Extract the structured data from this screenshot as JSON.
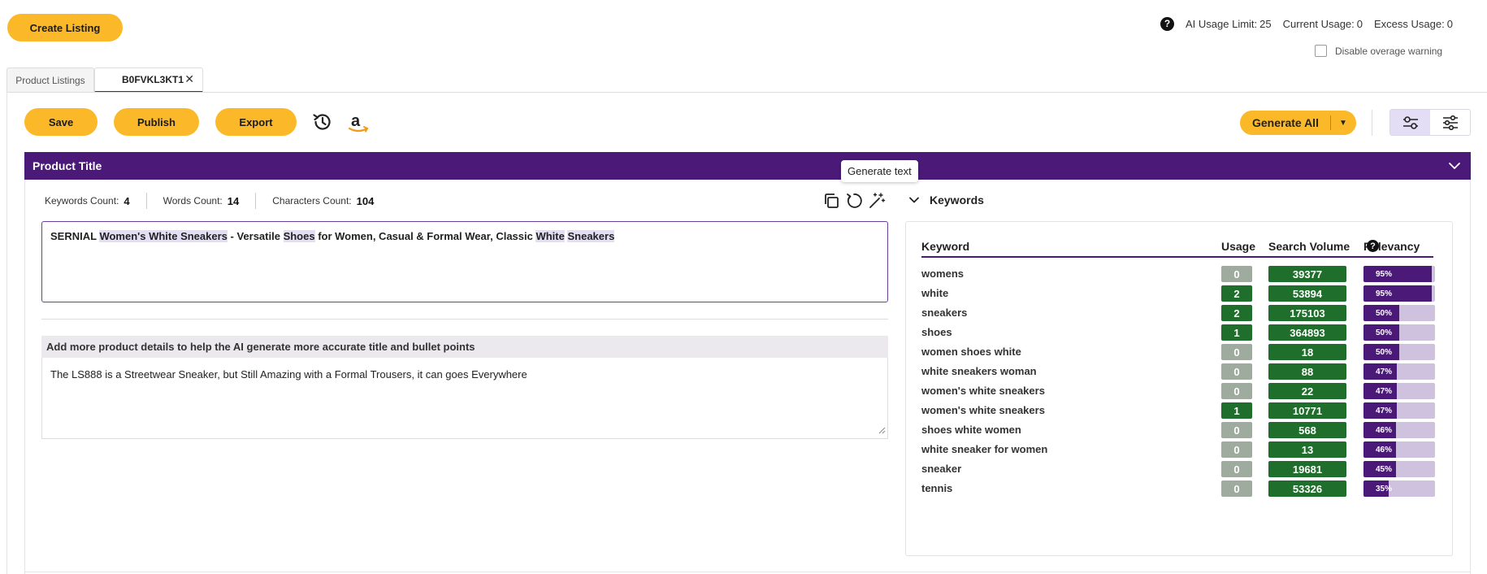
{
  "header": {
    "create_listing": "Create Listing",
    "ai_usage_limit_label": "AI Usage Limit:",
    "ai_usage_limit_value": "25",
    "current_usage_label": "Current Usage:",
    "current_usage_value": "0",
    "excess_usage_label": "Excess Usage:",
    "excess_usage_value": "0",
    "help_glyph": "?",
    "disable_overage": "Disable overage warning"
  },
  "tabs": {
    "product_listings": "Product Listings",
    "active_tab": "B0FVKL3KT1",
    "close_glyph": "✕"
  },
  "toolbar": {
    "save": "Save",
    "publish": "Publish",
    "export": "Export",
    "generate_all": "Generate All",
    "caret": "▼"
  },
  "section": {
    "title": "Product Title",
    "tooltip": "Generate text"
  },
  "counts": {
    "keywords_label": "Keywords Count:",
    "keywords_value": "4",
    "words_label": "Words Count:",
    "words_value": "14",
    "characters_label": "Characters Count:",
    "characters_value": "104"
  },
  "title_text": {
    "p1": "SERNIAL ",
    "h1": "Women's White Sneakers",
    "p2": " - Versatile ",
    "h2": "Shoes",
    "p3": " for Women, Casual & Formal Wear, Classic ",
    "h3": "White",
    "p4": " ",
    "h4": "Sneakers"
  },
  "details": {
    "heading": "Add more product details to help the AI generate more accurate title and bullet points",
    "text": "The LS888 is a Streetwear Sneaker, but Still Amazing with a Formal Trousers, it can goes Everywhere"
  },
  "keywords": {
    "toggle_label": "Keywords",
    "col_keyword": "Keyword",
    "col_usage": "Usage",
    "col_volume": "Search Volume",
    "col_relevancy": "Relevancy",
    "colors": {
      "used": "#1f6e2c",
      "unused": "#9fab9f",
      "relevancy": "#4b1a78"
    },
    "rows": [
      {
        "keyword": "womens",
        "usage": "0",
        "volume": "39377",
        "relevancy": 95,
        "relevancy_label": "95%"
      },
      {
        "keyword": "white",
        "usage": "2",
        "volume": "53894",
        "relevancy": 95,
        "relevancy_label": "95%"
      },
      {
        "keyword": "sneakers",
        "usage": "2",
        "volume": "175103",
        "relevancy": 50,
        "relevancy_label": "50%"
      },
      {
        "keyword": "shoes",
        "usage": "1",
        "volume": "364893",
        "relevancy": 50,
        "relevancy_label": "50%"
      },
      {
        "keyword": "women shoes white",
        "usage": "0",
        "volume": "18",
        "relevancy": 50,
        "relevancy_label": "50%"
      },
      {
        "keyword": "white sneakers woman",
        "usage": "0",
        "volume": "88",
        "relevancy": 47,
        "relevancy_label": "47%"
      },
      {
        "keyword": "women's white sneakers",
        "usage": "0",
        "volume": "22",
        "relevancy": 47,
        "relevancy_label": "47%"
      },
      {
        "keyword": "women's white sneakers",
        "usage": "1",
        "volume": "10771",
        "relevancy": 47,
        "relevancy_label": "47%"
      },
      {
        "keyword": "shoes white women",
        "usage": "0",
        "volume": "568",
        "relevancy": 46,
        "relevancy_label": "46%"
      },
      {
        "keyword": "white sneaker for women",
        "usage": "0",
        "volume": "13",
        "relevancy": 46,
        "relevancy_label": "46%"
      },
      {
        "keyword": "sneaker",
        "usage": "0",
        "volume": "19681",
        "relevancy": 45,
        "relevancy_label": "45%"
      },
      {
        "keyword": "tennis",
        "usage": "0",
        "volume": "53326",
        "relevancy": 35,
        "relevancy_label": "35%"
      }
    ]
  }
}
